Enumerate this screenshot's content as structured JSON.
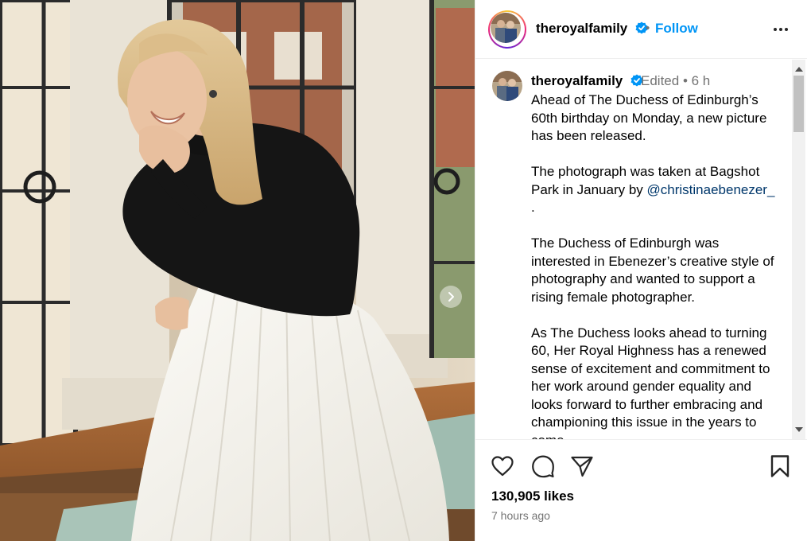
{
  "post": {
    "username": "theroyalfamily",
    "follow_label": "Follow",
    "separator": "•",
    "edited_label": "Edited",
    "time_short": "6 h",
    "caption": {
      "p1": "Ahead of The Duchess of Edinburgh’s 60th birthday on Monday, a new picture has been released.",
      "p2_before": "The photograph was taken at Bagshot Park in January by ",
      "p2_mention": "@christinaebenezer_",
      "p2_after": ".",
      "p3": "The Duchess of Edinburgh was interested in Ebenezer’s creative style of photography and wanted to support a rising female photographer.",
      "p4": "As The Duchess looks ahead to turning 60, Her Royal Highness has a renewed sense of excitement and commitment to her work around gender equality and looks forward to further embracing and championing this issue in the years to come."
    },
    "likes": "130,905 likes",
    "time_ago": "7 hours ago"
  },
  "icons": {
    "verified": "verified-badge-icon",
    "more": "more-options-icon",
    "like": "heart-icon",
    "comment": "comment-icon",
    "share": "share-icon",
    "save": "bookmark-icon",
    "next": "chevron-right-icon"
  },
  "colors": {
    "accent": "#0095f6",
    "mention": "#00376b",
    "muted": "#737373",
    "text": "#000000",
    "border": "#efefef"
  }
}
